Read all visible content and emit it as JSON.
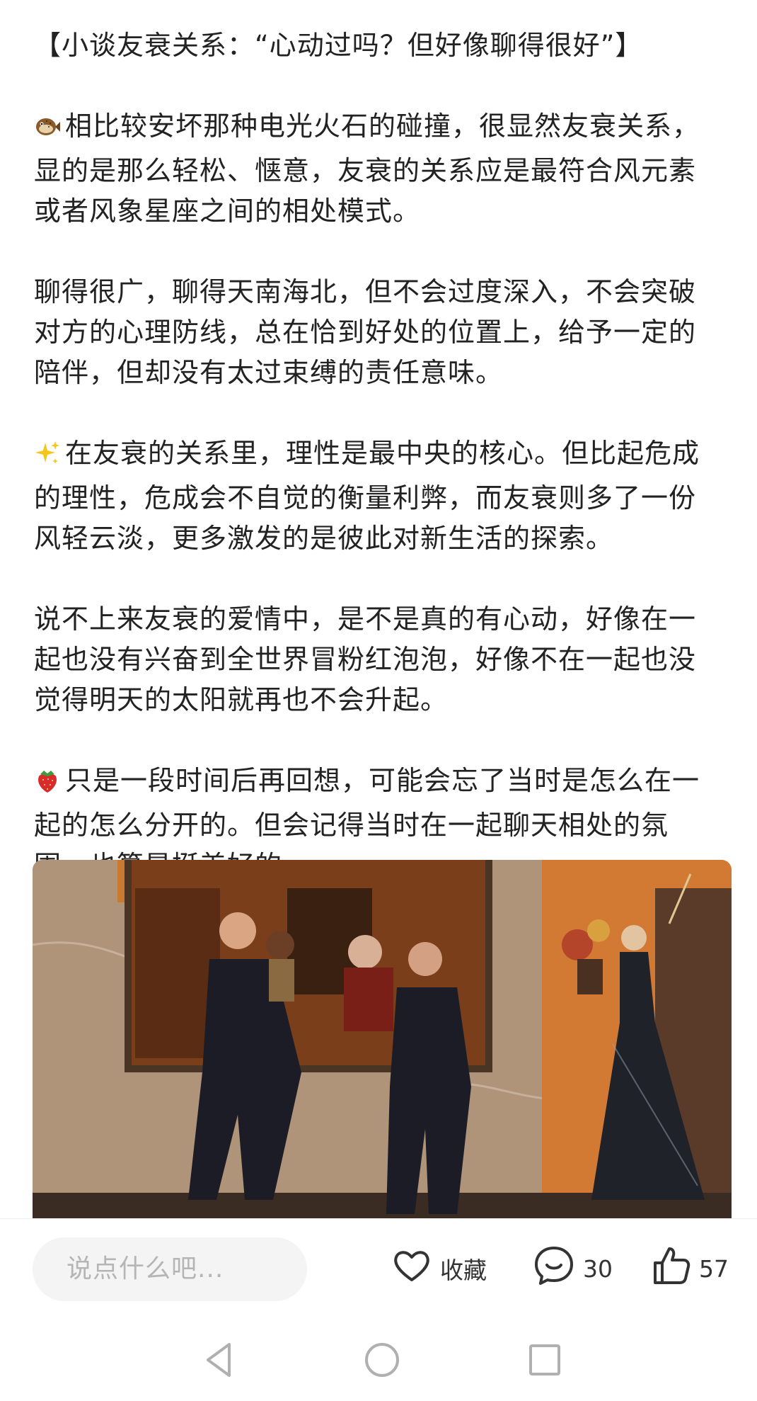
{
  "article": {
    "title": "【小谈友衰关系：“心动过吗？但好像聊得很好”】",
    "paragraphs": [
      {
        "icon": "pufferfish-icon",
        "text": "相比较安坏那种电光火石的碰撞，很显然友衰关系，显的是那么轻松、惬意，友衰的关系应是最符合风元素或者风象星座之间的相处模式。"
      },
      {
        "icon": "",
        "text": "聊得很广，聊得天南海北，但不会过度深入，不会突破对方的心理防线，总在恰到好处的位置上，给予一定的陪伴，但却没有太过束缚的责任意味。"
      },
      {
        "icon": "sparkles-icon",
        "text": "在友衰的关系里，理性是最中央的核心。但比起危成的理性，危成会不自觉的衡量利弊，而友衰则多了一份风轻云淡，更多激发的是彼此对新生活的探索。"
      },
      {
        "icon": "",
        "text": "说不上来友衰的爱情中，是不是真的有心动，好像在一起也没有兴奋到全世界冒粉红泡泡，好像不在一起也没觉得明天的太阳就再也不会升起。"
      },
      {
        "icon": "strawberry-icon",
        "text": "只是一段时间后再回想，可能会忘了当时是怎么在一起的怎么分开的。但会记得当时在一起聊天相处的氛围，也算是挺美好的。"
      }
    ]
  },
  "bottom_bar": {
    "comment_placeholder": "说点什么吧...",
    "favorite_label": "收藏",
    "comment_count": "30",
    "like_count": "57"
  },
  "icons": {
    "favorite": "heart-icon",
    "comment": "chat-bubble-icon",
    "like": "thumbs-up-icon",
    "nav_back": "triangle-back-icon",
    "nav_home": "circle-home-icon",
    "nav_recent": "square-recents-icon"
  },
  "colors": {
    "text": "#222222",
    "placeholder": "#b5b5b5",
    "input_bg": "#f4f4f4",
    "icon": "#333333"
  }
}
